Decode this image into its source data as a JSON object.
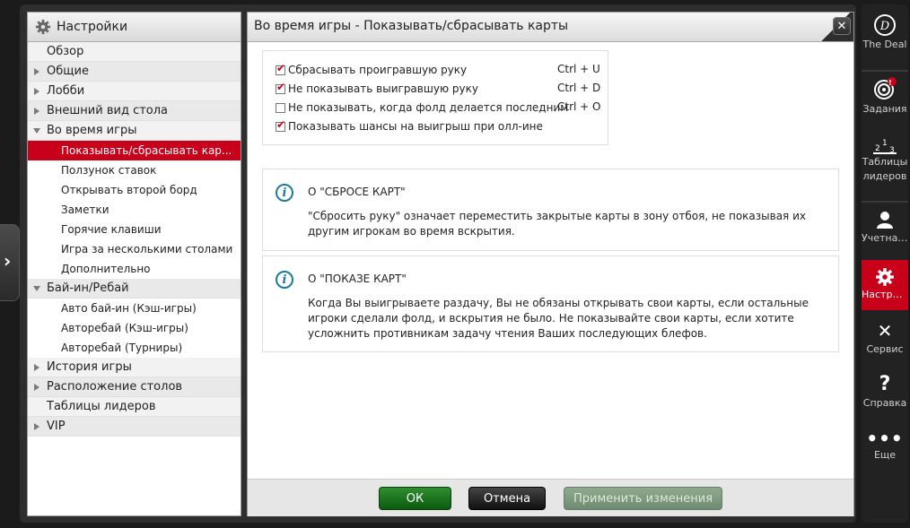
{
  "left": {
    "title": "Настройки",
    "items": [
      {
        "label": "Обзор",
        "level": 0,
        "arrow": "none"
      },
      {
        "label": "Общие",
        "level": 0,
        "arrow": "right"
      },
      {
        "label": "Лобби",
        "level": 0,
        "arrow": "right"
      },
      {
        "label": "Внешний вид стола",
        "level": 0,
        "arrow": "right"
      },
      {
        "label": "Во время игры",
        "level": 0,
        "arrow": "down"
      },
      {
        "label": "Показывать/сбрасывать кар...",
        "level": 1,
        "active": true
      },
      {
        "label": "Ползунок ставок",
        "level": 1
      },
      {
        "label": "Открывать второй борд",
        "level": 1
      },
      {
        "label": "Заметки",
        "level": 1
      },
      {
        "label": "Горячие клавиши",
        "level": 1
      },
      {
        "label": "Игра за несколькими столами",
        "level": 1
      },
      {
        "label": "Дополнительно",
        "level": 1
      },
      {
        "label": "Бай-ин/Ребай",
        "level": 0,
        "arrow": "down"
      },
      {
        "label": "Авто бай-ин (Кэш-игры)",
        "level": 1
      },
      {
        "label": "Авторебай (Кэш-игры)",
        "level": 1
      },
      {
        "label": "Авторебай (Турниры)",
        "level": 1
      },
      {
        "label": "История игры",
        "level": 0,
        "arrow": "right"
      },
      {
        "label": "Расположение столов",
        "level": 0,
        "arrow": "right"
      },
      {
        "label": "Таблицы лидеров",
        "level": 0,
        "arrow": "none"
      },
      {
        "label": "VIP",
        "level": 0,
        "arrow": "right"
      }
    ]
  },
  "main": {
    "title": "Во время игры - Показывать/сбрасывать карты",
    "close": "✕",
    "options": [
      {
        "label": "Сбрасывать проигравшую руку",
        "checked": true,
        "hotkey": "Ctrl + U"
      },
      {
        "label": "Не показывать выигравшую руку",
        "checked": true,
        "hotkey": "Ctrl + D"
      },
      {
        "label": "Не показывать, когда фолд делается последним",
        "checked": false,
        "hotkey": "Ctrl + O"
      },
      {
        "label": "Показывать шансы на выигрыш при олл-ине",
        "checked": true,
        "hotkey": ""
      }
    ],
    "info1": {
      "heading": "О \"СБРОСЕ КАРТ\"",
      "text": "\"Сбросить руку\" означает переместить закрытые карты в зону отбоя, не показывая их другим игрокам во время вскрытия."
    },
    "info2": {
      "heading": "О \"ПОКАЗЕ КАРТ\"",
      "text": "Когда Вы выигрываете раздачу, Вы не обязаны открывать свои карты, если остальные игроки сделали фолд, и вскрытия не было. Не показывайте свои карты, если хотите усложнить противникам задачу чтения Ваших последующих блефов."
    },
    "buttons": {
      "ok": "ОК",
      "cancel": "Отмена",
      "apply": "Применить изменения"
    }
  },
  "sidebar": {
    "deal": "The Deal",
    "tasks": "Задания",
    "tasks_badge": "!",
    "leaders": "Таблицы лидеров",
    "account": "Учетная ...",
    "settings": "Настрой...",
    "service": "Сервис",
    "help": "Справка",
    "more": "Еще"
  },
  "colors": {
    "accent": "#c8001a",
    "ok": "#1f7a23",
    "info_icon": "#1d7a9c"
  }
}
